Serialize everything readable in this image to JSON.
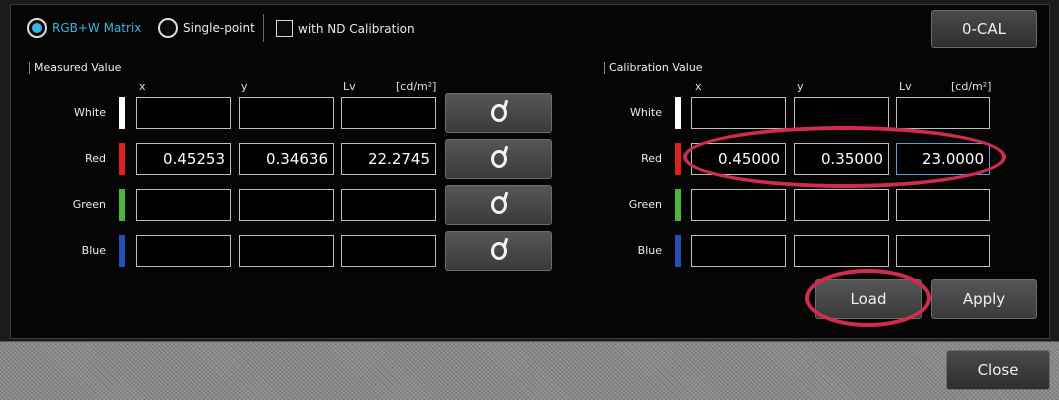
{
  "mode": {
    "rgbw_label": "RGB+W Matrix",
    "single_label": "Single-point",
    "selected": "rgbw",
    "nd_label": "with ND Calibration",
    "nd_checked": false
  },
  "zero_cal_label": "0-CAL",
  "measured": {
    "title": "Measured Value",
    "headers": {
      "x": "x",
      "y": "y",
      "lv": "Lv",
      "unit": "[cd/m²]"
    },
    "rows": {
      "white": {
        "label": "White",
        "x": "",
        "y": "",
        "lv": ""
      },
      "red": {
        "label": "Red",
        "x": "0.45253",
        "y": "0.34636",
        "lv": "22.2745"
      },
      "green": {
        "label": "Green",
        "x": "",
        "y": "",
        "lv": ""
      },
      "blue": {
        "label": "Blue",
        "x": "",
        "y": "",
        "lv": ""
      }
    }
  },
  "calibration": {
    "title": "Calibration Value",
    "headers": {
      "x": "x",
      "y": "y",
      "lv": "Lv",
      "unit": "[cd/m²]"
    },
    "rows": {
      "white": {
        "label": "White",
        "x": "",
        "y": "",
        "lv": ""
      },
      "red": {
        "label": "Red",
        "x": "0.45000",
        "y": "0.35000",
        "lv": "23.0000"
      },
      "green": {
        "label": "Green",
        "x": "",
        "y": "",
        "lv": ""
      },
      "blue": {
        "label": "Blue",
        "x": "",
        "y": "",
        "lv": ""
      }
    }
  },
  "buttons": {
    "load": "Load",
    "apply": "Apply",
    "close": "Close"
  },
  "colors": {
    "white": "#ffffff",
    "red": "#e01f1f",
    "green": "#4fb33c",
    "blue": "#2450b8",
    "accent": "#36b6e0",
    "highlight": "#d12b50"
  },
  "icons": {
    "measure": "measure-icon"
  }
}
